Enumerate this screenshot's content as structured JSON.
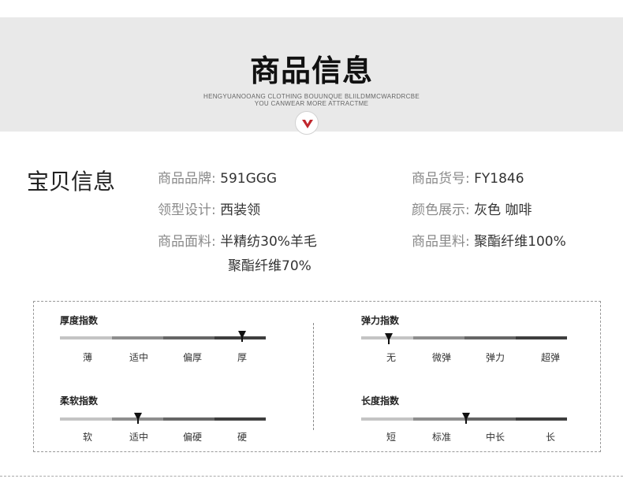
{
  "banner": {
    "title": "商品信息",
    "subtitle_line1": "HENGYUANOOANG CLOTHING BOUUNQUE BLIILDMMCWARDRCBE",
    "subtitle_line2": "YOU CANWEAR MORE ATTRACTME",
    "badge_icon": "chevron-down-icon",
    "accent_color": "#c0272d"
  },
  "info": {
    "title": "宝贝信息",
    "brand_label": "商品品牌:",
    "brand_value": "591GGG",
    "sku_label": "商品货号:",
    "sku_value": "FY1846",
    "collar_label": "领型设计:",
    "collar_value": "西装领",
    "color_label": "颜色展示:",
    "color_value": "灰色 咖啡",
    "fabric_label": "商品面料:",
    "fabric_value_1": "半精纺30%羊毛",
    "fabric_value_2": "聚酯纤维70%",
    "lining_label": "商品里料:",
    "lining_value": "聚酯纤维100%"
  },
  "indices": {
    "thickness": {
      "title": "厚度指数",
      "levels": [
        "薄",
        "适中",
        "偏厚",
        "厚"
      ],
      "selected_index": 3
    },
    "elasticity": {
      "title": "弹力指数",
      "levels": [
        "无",
        "微弹",
        "弹力",
        "超弹"
      ],
      "selected_index": 0
    },
    "softness": {
      "title": "柔软指数",
      "levels": [
        "软",
        "适中",
        "偏硬",
        "硬"
      ],
      "selected_index": 1
    },
    "length": {
      "title": "长度指数",
      "levels": [
        "短",
        "标准",
        "中长",
        "长"
      ],
      "selected_index": 2
    }
  }
}
